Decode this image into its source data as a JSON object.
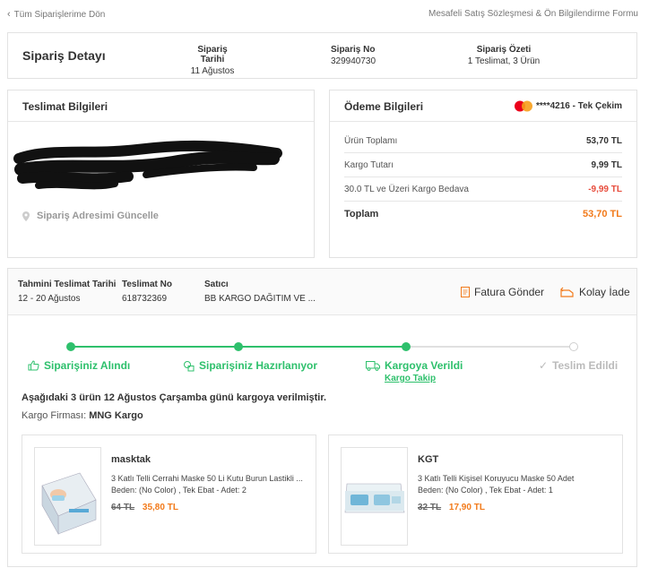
{
  "topbar": {
    "back_label": "Tüm Siparişlerime Dön",
    "contract_link": "Mesafeli Satış Sözleşmesi & Ön Bilgilendirme Formu"
  },
  "order_header": {
    "title": "Sipariş Detayı",
    "date_label": "Sipariş Tarihi",
    "date_value": "11 Ağustos",
    "no_label": "Sipariş No",
    "no_value": "329940730",
    "summary_label": "Sipariş Özeti",
    "summary_value": "1 Teslimat, 3 Ürün"
  },
  "delivery_info": {
    "title": "Teslimat Bilgileri",
    "update_address": "Sipariş Adresimi Güncelle"
  },
  "payment_info": {
    "title": "Ödeme Bilgileri",
    "card_text": "****4216 - Tek Çekim",
    "rows": [
      {
        "label": "Ürün Toplamı",
        "value": "53,70 TL"
      },
      {
        "label": "Kargo Tutarı",
        "value": "9,99 TL"
      },
      {
        "label": "30.0 TL ve Üzeri Kargo Bedava",
        "value": "-9,99 TL"
      }
    ],
    "total_label": "Toplam",
    "total_value": "53,70 TL",
    "colors": {
      "discount": "#e74c3c",
      "total": "#f27a1a"
    }
  },
  "shipment": {
    "eta_label": "Tahmini Teslimat Tarihi",
    "eta_value": "12 - 20 Ağustos",
    "shipment_no_label": "Teslimat No",
    "shipment_no_value": "618732369",
    "seller_label": "Satıcı",
    "seller_value": "BB KARGO DAĞITIM VE ...",
    "invoice_button": "Fatura Gönder",
    "return_button": "Kolay İade",
    "steps": [
      {
        "label": "Siparişiniz Alındı",
        "done": true
      },
      {
        "label": "Siparişiniz Hazırlanıyor",
        "done": true
      },
      {
        "label": "Kargoya Verildi",
        "done": true
      },
      {
        "label": "Teslim Edildi",
        "done": false
      }
    ],
    "tracking_link": "Kargo Takip",
    "message": "Aşağıdaki 3 ürün 12 Ağustos Çarşamba günü kargoya verilmiştir.",
    "carrier_label": "Kargo Firması:",
    "carrier_value": "MNG Kargo",
    "colors": {
      "active": "#2ec06c",
      "inactive": "#cfcfcf"
    }
  },
  "products": [
    {
      "seller": "masktak",
      "name": "3 Katlı Telli Cerrahi Maske 50 Li Kutu Burun Lastikli ...",
      "variant": "Beden: (No Color) , Tek Ebat - Adet: 2",
      "old_price": "64 TL",
      "price": "35,80 TL"
    },
    {
      "seller": "KGT",
      "name": "3 Katlı Telli Kişisel Koruyucu Maske 50 Adet",
      "variant": "Beden: (No Color) , Tek Ebat - Adet: 1",
      "old_price": "32 TL",
      "price": "17,90 TL"
    }
  ]
}
